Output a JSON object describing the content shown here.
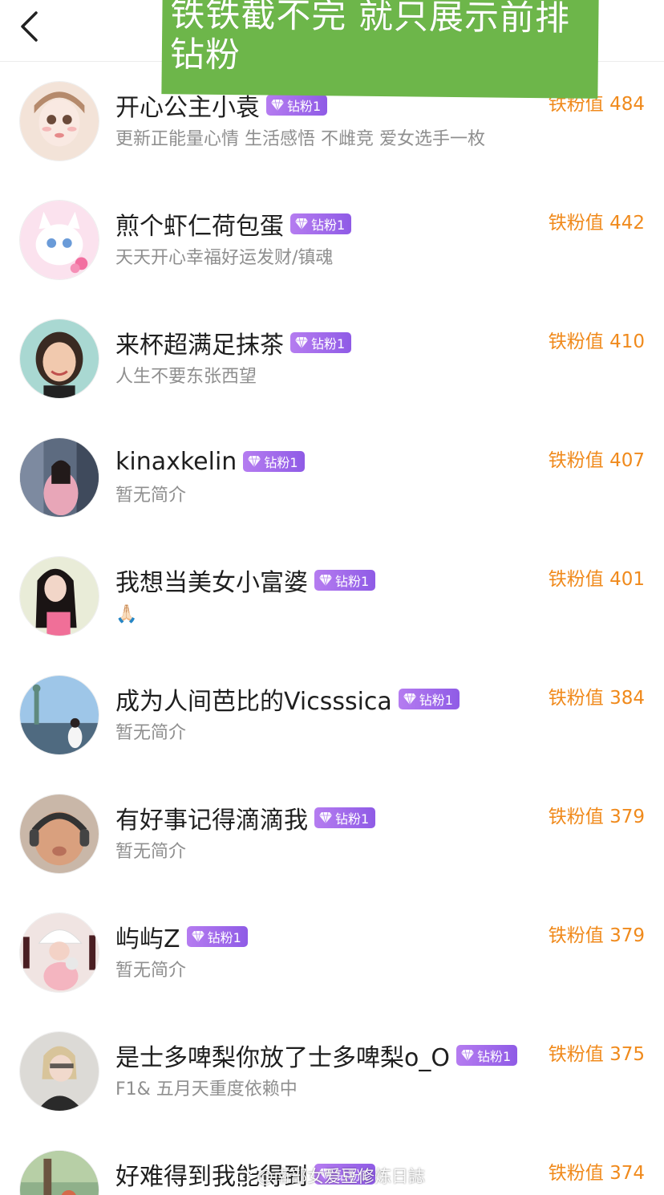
{
  "header": {
    "back_icon": "chevron-left-icon"
  },
  "overlay_note": {
    "line1": "铁铁截不完 就只展示前排",
    "line2": "钻粉"
  },
  "badge_label": "钻粉1",
  "score_prefix": "铁粉值",
  "colors": {
    "score": "#f08a1c",
    "badge_start": "#b57cf0",
    "badge_end": "#8f5be6",
    "note_bg": "#6db64a"
  },
  "fans": [
    {
      "name": "开心公主小袁",
      "badge": "钻粉1",
      "bio": "更新正能量心情 生活感悟 不雌竞 爱女选手一枚",
      "score": "铁粉值 484"
    },
    {
      "name": "煎个虾仁荷包蛋",
      "badge": "钻粉1",
      "bio": "天天开心幸福好运发财/镇魂",
      "score": "铁粉值 442"
    },
    {
      "name": "来杯超满足抹茶",
      "badge": "钻粉1",
      "bio": "人生不要东张西望",
      "score": "铁粉值 410"
    },
    {
      "name": "kinaxkelin",
      "badge": "钻粉1",
      "bio": "暂无简介",
      "score": "铁粉值 407"
    },
    {
      "name": "我想当美女小富婆",
      "badge": "钻粉1",
      "bio": "🙏🏻",
      "score": "铁粉值 401"
    },
    {
      "name": "成为人间芭比的Vicsssica",
      "badge": "钻粉1",
      "bio": "暂无简介",
      "score": "铁粉值 384"
    },
    {
      "name": "有好事记得滴滴我",
      "badge": "钻粉1",
      "bio": "暂无简介",
      "score": "铁粉值 379"
    },
    {
      "name": "屿屿Z",
      "badge": "钻粉1",
      "bio": "暂无简介",
      "score": "铁粉值 379"
    },
    {
      "name": "是士多啤梨你放了士多啤梨o_O",
      "badge": "钻粉1",
      "bio": "F1& 五月天重度依赖中",
      "score": "铁粉值 375"
    },
    {
      "name": "好难得到我能得到",
      "badge": "钻粉1",
      "bio": "",
      "score": "铁粉值 374"
    }
  ],
  "watermark": "@南部女爱豆修炼日誌"
}
